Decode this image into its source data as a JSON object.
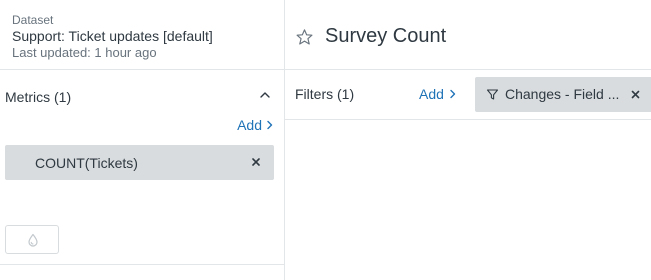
{
  "dataset": {
    "caption": "Dataset",
    "name": "Support: Ticket updates [default]",
    "last_updated": "Last updated: 1 hour ago"
  },
  "metrics": {
    "title": "Metrics (1)",
    "add_label": "Add",
    "items": [
      {
        "label": "COUNT(Tickets)"
      }
    ]
  },
  "report": {
    "title": "Survey Count"
  },
  "filters": {
    "title": "Filters (1)",
    "add_label": "Add",
    "items": [
      {
        "label": "Changes - Field ..."
      }
    ]
  },
  "icons": {
    "chevron": "chevron-up-icon",
    "add_chevron": "chevron-right-icon",
    "remove": "close-icon",
    "color": "drop-icon",
    "favorite": "star-icon",
    "filter": "funnel-icon"
  },
  "colors": {
    "accent": "#1f73b7",
    "text": "#2f3941",
    "muted": "#68737d",
    "pill": "#d8dcde",
    "divider": "#e3e6e8"
  }
}
